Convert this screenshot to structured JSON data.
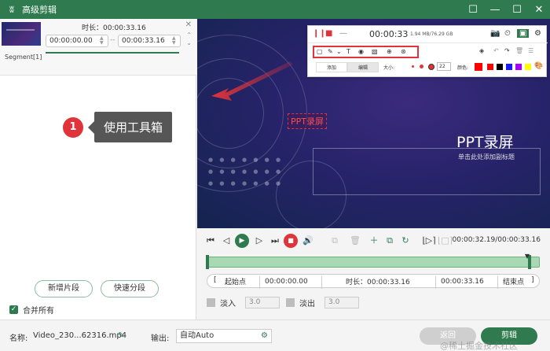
{
  "window": {
    "title": "高级剪辑",
    "app_icon": "app-logo-icon"
  },
  "segment": {
    "label": "Segment[1]",
    "duration_label": "时长：00:00:33.16",
    "start": "00:00:00.00",
    "end": "00:00:33.16"
  },
  "callout": {
    "number": "1",
    "text": "使用工具箱"
  },
  "left_buttons": {
    "add_segment": "新增片段",
    "quick_split": "快速分段"
  },
  "merge_all": {
    "label": "合并所有",
    "checked": true
  },
  "preview": {
    "title": "PPT录屏",
    "subtitle": "单击此处添加副标题",
    "red_label": "PPT录屏"
  },
  "toolbox": {
    "timer": "00:00:33",
    "size_info": "1.94 MB/76.29 GB",
    "tab_add": "添加",
    "tab_edit": "编辑",
    "size_label": "大小:",
    "font_size": "22",
    "color_label": "颜色:",
    "colors": [
      "#ff0000",
      "#ff0000",
      "#000000",
      "#1a1aff",
      "#aa00ff",
      "#ffff00"
    ]
  },
  "player": {
    "time": "00:00:32.19/00:00:33.16"
  },
  "trim": {
    "start_btn": "起始点",
    "start_time": "00:00:00.00",
    "duration": "时长：00:00:33.16",
    "end_time": "00:00:33.16",
    "end_btn": "结束点"
  },
  "fade": {
    "in_label": "淡入",
    "in_value": "3.0",
    "out_label": "淡出",
    "out_value": "3.0"
  },
  "bottom": {
    "name_label": "名称:",
    "name_value": "Video_230...62316.mp4",
    "output_label": "输出:",
    "output_value": "自动Auto",
    "back_button": "返回",
    "cut_button": "剪辑",
    "watermark": "@稀土掘金技术社区"
  }
}
